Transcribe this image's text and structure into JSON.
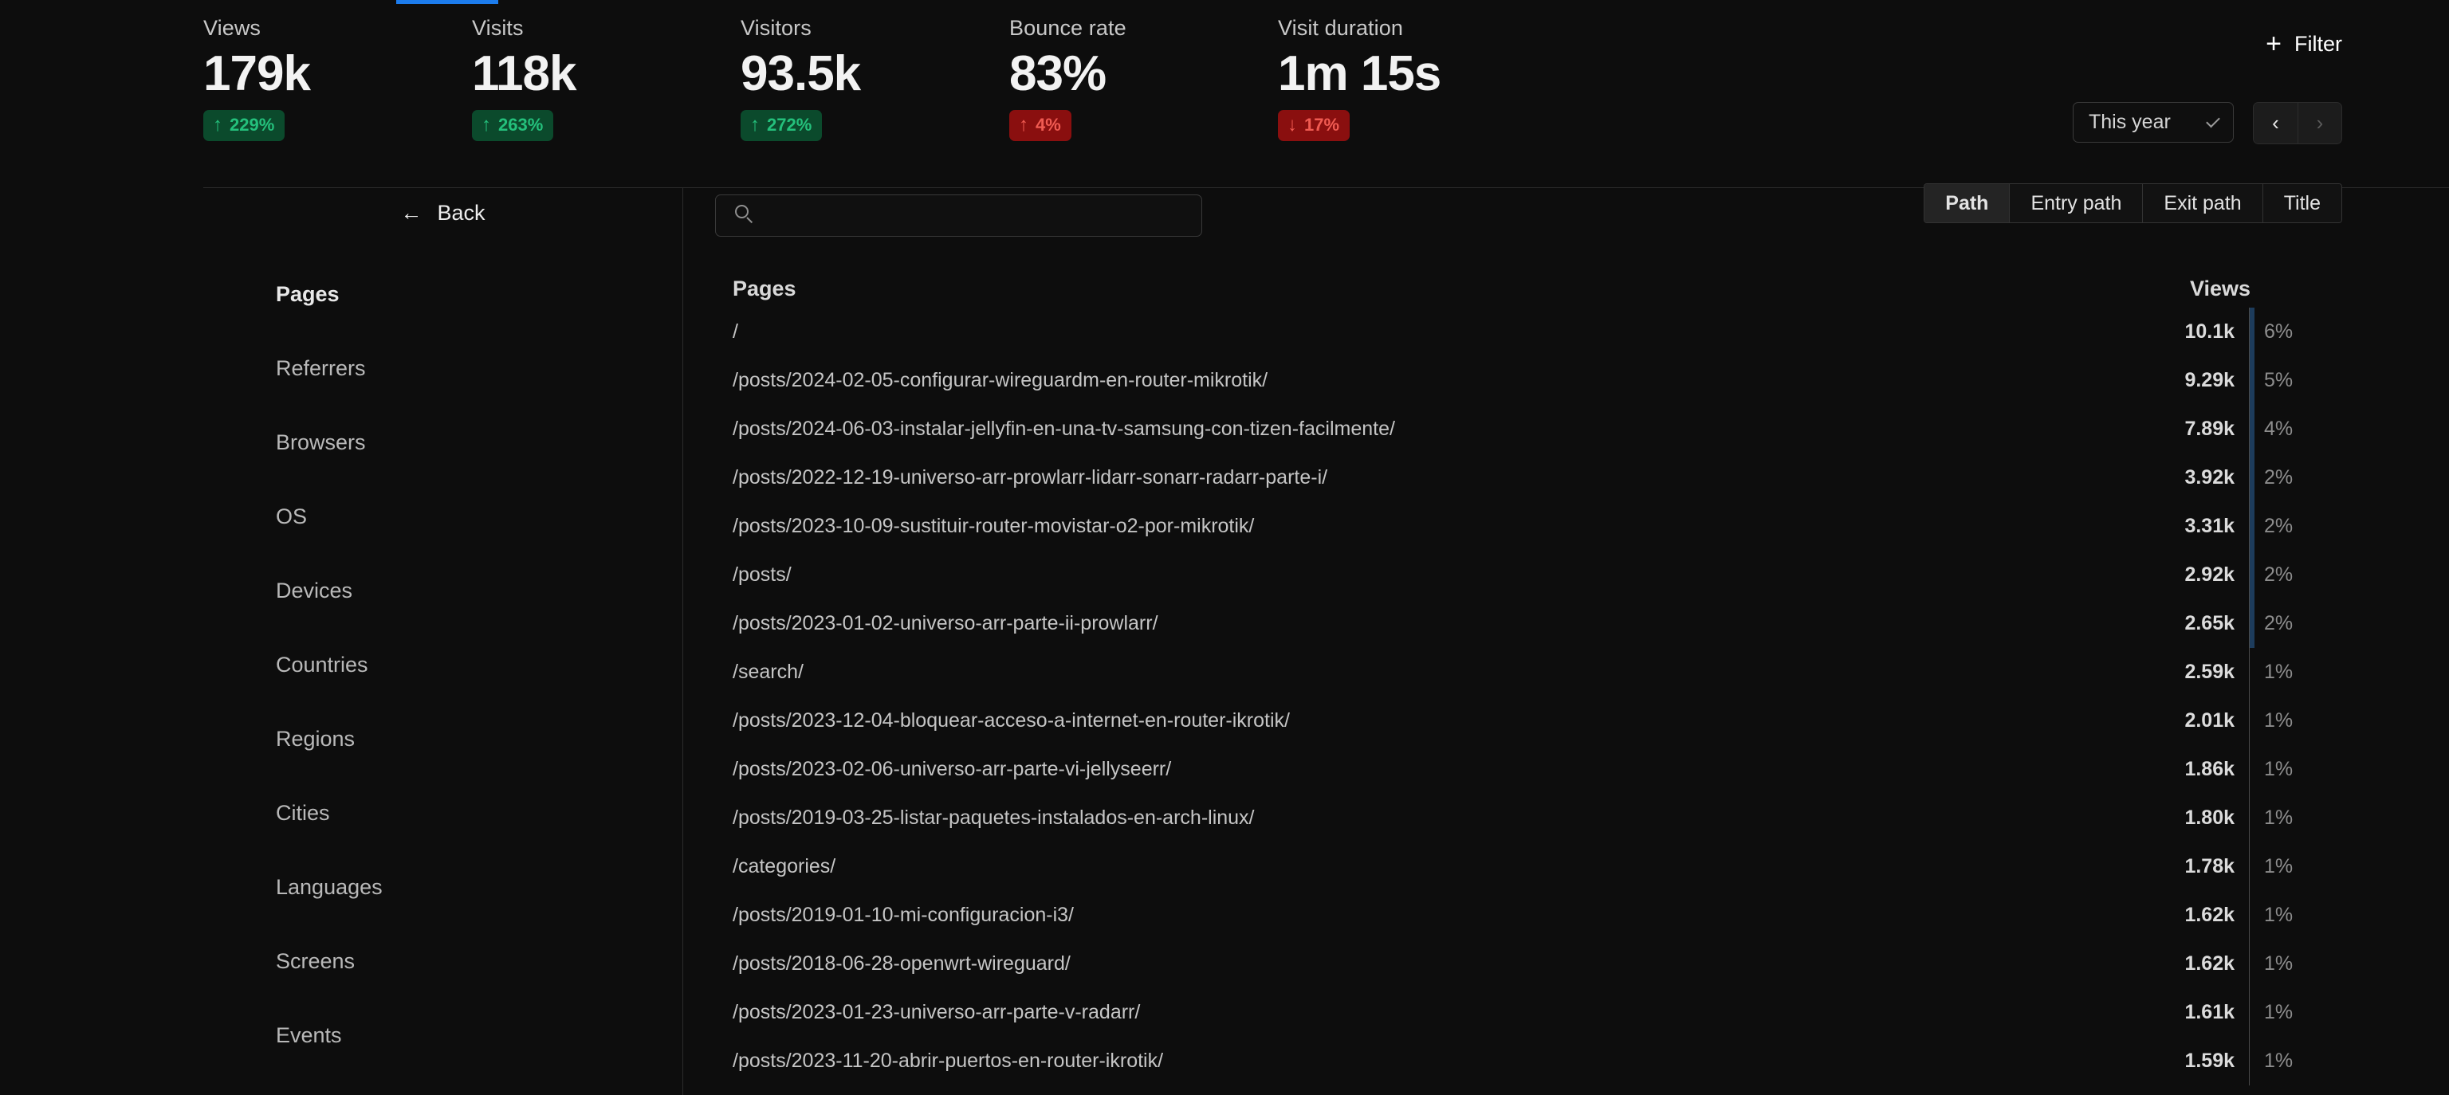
{
  "metrics": [
    {
      "label": "Views",
      "value": "179k",
      "change": "229%",
      "direction": "up",
      "arrow": "↑",
      "active": true
    },
    {
      "label": "Visits",
      "value": "118k",
      "change": "263%",
      "direction": "up",
      "arrow": "↑",
      "active": false
    },
    {
      "label": "Visitors",
      "value": "93.5k",
      "change": "272%",
      "direction": "up",
      "arrow": "↑",
      "active": false
    },
    {
      "label": "Bounce rate",
      "value": "83%",
      "change": "4%",
      "direction": "down",
      "arrow": "↑",
      "active": false
    },
    {
      "label": "Visit duration",
      "value": "1m 15s",
      "change": "17%",
      "direction": "down",
      "arrow": "↓",
      "active": false
    }
  ],
  "toolbar": {
    "filter_label": "Filter",
    "filter_icon": "plus-icon",
    "date_range_value": "This year",
    "date_range_icon": "chevron-down-icon",
    "prev_label": "‹",
    "next_label": "›"
  },
  "sidebar": {
    "back_label": "Back",
    "back_icon": "arrow-left-icon",
    "items": [
      {
        "label": "Pages",
        "active": true
      },
      {
        "label": "Referrers",
        "active": false
      },
      {
        "label": "Browsers",
        "active": false
      },
      {
        "label": "OS",
        "active": false
      },
      {
        "label": "Devices",
        "active": false
      },
      {
        "label": "Countries",
        "active": false
      },
      {
        "label": "Regions",
        "active": false
      },
      {
        "label": "Cities",
        "active": false
      },
      {
        "label": "Languages",
        "active": false
      },
      {
        "label": "Screens",
        "active": false
      },
      {
        "label": "Events",
        "active": false
      }
    ]
  },
  "search": {
    "value": "",
    "placeholder": "",
    "icon": "search-icon"
  },
  "tabs": [
    {
      "label": "Path",
      "active": true
    },
    {
      "label": "Entry path",
      "active": false
    },
    {
      "label": "Exit path",
      "active": false
    },
    {
      "label": "Title",
      "active": false
    }
  ],
  "table": {
    "columns": {
      "pages": "Pages",
      "views": "Views"
    },
    "rows": [
      {
        "path": "/",
        "views": "10.1k",
        "pct": "6%"
      },
      {
        "path": "/posts/2024-02-05-configurar-wireguardm-en-router-mikrotik/",
        "views": "9.29k",
        "pct": "5%"
      },
      {
        "path": "/posts/2024-06-03-instalar-jellyfin-en-una-tv-samsung-con-tizen-facilmente/",
        "views": "7.89k",
        "pct": "4%"
      },
      {
        "path": "/posts/2022-12-19-universo-arr-prowlarr-lidarr-sonarr-radarr-parte-i/",
        "views": "3.92k",
        "pct": "2%"
      },
      {
        "path": "/posts/2023-10-09-sustituir-router-movistar-o2-por-mikrotik/",
        "views": "3.31k",
        "pct": "2%"
      },
      {
        "path": "/posts/",
        "views": "2.92k",
        "pct": "2%"
      },
      {
        "path": "/posts/2023-01-02-universo-arr-parte-ii-prowlarr/",
        "views": "2.65k",
        "pct": "2%"
      },
      {
        "path": "/search/",
        "views": "2.59k",
        "pct": "1%"
      },
      {
        "path": "/posts/2023-12-04-bloquear-acceso-a-internet-en-router-ikrotik/",
        "views": "2.01k",
        "pct": "1%"
      },
      {
        "path": "/posts/2023-02-06-universo-arr-parte-vi-jellyseerr/",
        "views": "1.86k",
        "pct": "1%"
      },
      {
        "path": "/posts/2019-03-25-listar-paquetes-instalados-en-arch-linux/",
        "views": "1.80k",
        "pct": "1%"
      },
      {
        "path": "/categories/",
        "views": "1.78k",
        "pct": "1%"
      },
      {
        "path": "/posts/2019-01-10-mi-configuracion-i3/",
        "views": "1.62k",
        "pct": "1%"
      },
      {
        "path": "/posts/2018-06-28-openwrt-wireguard/",
        "views": "1.62k",
        "pct": "1%"
      },
      {
        "path": "/posts/2023-01-23-universo-arr-parte-v-radarr/",
        "views": "1.61k",
        "pct": "1%"
      },
      {
        "path": "/posts/2023-11-20-abrir-puertos-en-router-ikrotik/",
        "views": "1.59k",
        "pct": "1%"
      }
    ]
  },
  "colors": {
    "background": "#0d0d0d",
    "accent_blue": "#1c7ced",
    "up_badge_bg": "#0b4a2c",
    "up_badge_fg": "#24c07c",
    "down_badge_bg": "#8a0f0f",
    "down_badge_fg": "#f05b52",
    "bar_blue": "#1d3c5c"
  }
}
